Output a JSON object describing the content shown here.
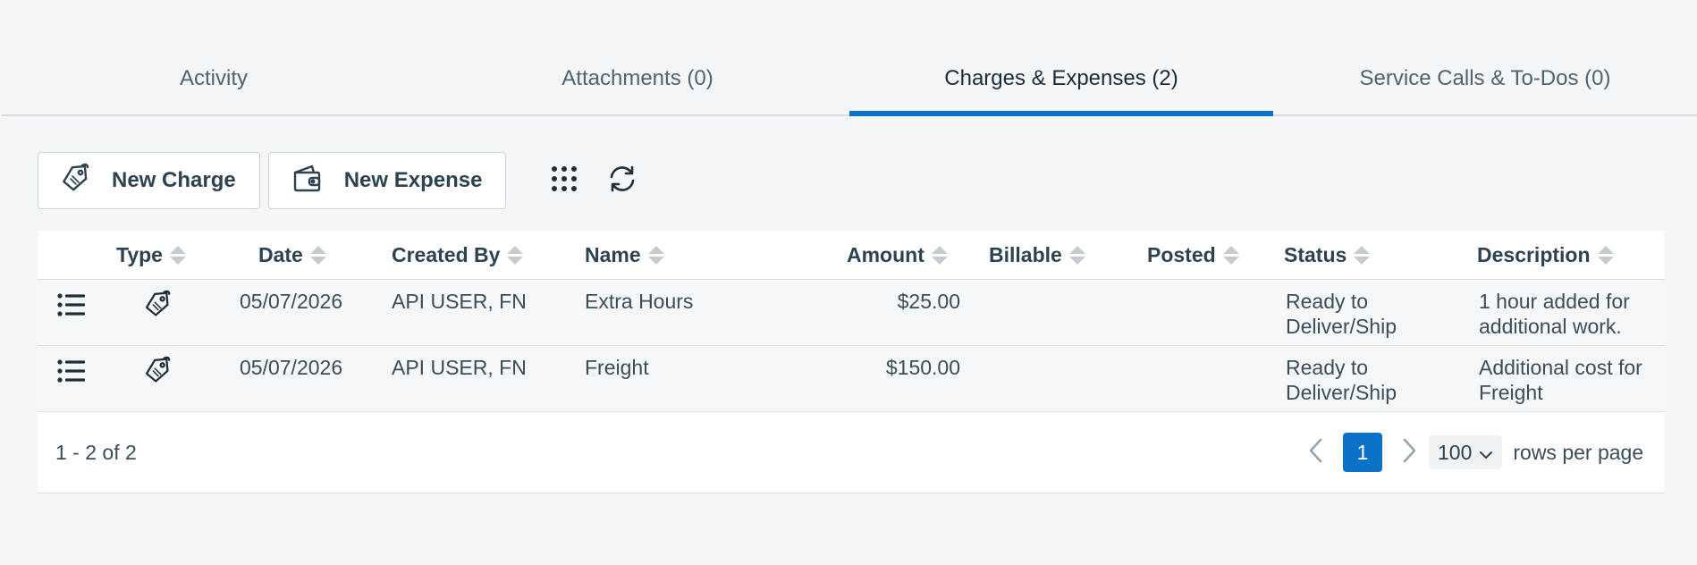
{
  "tabs": [
    {
      "label": "Activity"
    },
    {
      "label": "Attachments (0)"
    },
    {
      "label": "Charges & Expenses (2)"
    },
    {
      "label": "Service Calls & To-Dos (0)"
    }
  ],
  "toolbar": {
    "new_charge": "New Charge",
    "new_expense": "New Expense"
  },
  "columns": [
    "Type",
    "Date",
    "Created By",
    "Name",
    "Amount",
    "Billable",
    "Posted",
    "Status",
    "Description"
  ],
  "rows": [
    {
      "date": "05/07/2026",
      "created_by": "API USER, FN",
      "name": "Extra Hours",
      "amount": "$25.00",
      "status_l1": "Ready to",
      "status_l2": "Deliver/Ship",
      "desc_l1": "1 hour added for",
      "desc_l2": "additional work."
    },
    {
      "date": "05/07/2026",
      "created_by": "API USER, FN",
      "name": "Freight",
      "amount": "$150.00",
      "status_l1": "Ready to",
      "status_l2": "Deliver/Ship",
      "desc_l1": "Additional cost for",
      "desc_l2": "Freight"
    }
  ],
  "footer": {
    "count": "1 - 2 of 2",
    "page": "1",
    "rows_value": "100",
    "rows_label": "rows per page"
  },
  "colors": {
    "accent": "#0b72c7"
  }
}
